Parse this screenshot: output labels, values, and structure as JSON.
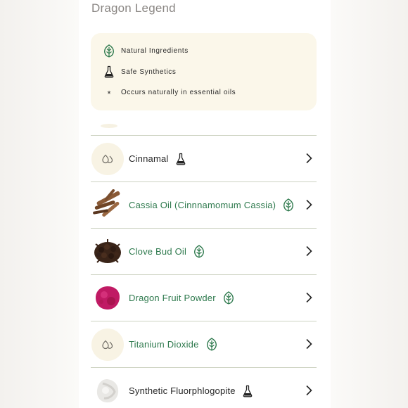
{
  "header": {
    "title": "Dragon Legend"
  },
  "legend": {
    "items": [
      {
        "icon": "leaf-icon",
        "label": "Natural Ingredients"
      },
      {
        "icon": "flask-icon",
        "label": "Safe Synthetics"
      },
      {
        "icon": "asterisk-icon",
        "symbol": "*",
        "label": "Occurs naturally in essential oils"
      }
    ]
  },
  "ingredients": [
    {
      "name": "Cinnamal",
      "type": "synthetic",
      "badge": "flask-icon",
      "thumb": "droplets-placeholder"
    },
    {
      "name": "Cassia Oil (Cinnnamomum Cassia)",
      "type": "natural",
      "badge": "leaf-icon",
      "thumb": "cassia-bark-image"
    },
    {
      "name": "Clove Bud Oil",
      "type": "natural",
      "badge": "leaf-icon",
      "thumb": "clove-buds-image"
    },
    {
      "name": "Dragon Fruit Powder",
      "type": "natural",
      "badge": "leaf-icon",
      "thumb": "dragon-fruit-powder-image"
    },
    {
      "name": "Titanium Dioxide",
      "type": "natural",
      "badge": "leaf-icon",
      "thumb": "droplets-placeholder"
    },
    {
      "name": "Synthetic Fluorphlogopite",
      "type": "synthetic",
      "badge": "flask-icon",
      "thumb": "mica-powder-image"
    }
  ],
  "colors": {
    "natural_text": "#2f7a4e",
    "legend_bg": "#fbf7ea",
    "divider": "#cdd3c2",
    "title": "#8a8683"
  }
}
